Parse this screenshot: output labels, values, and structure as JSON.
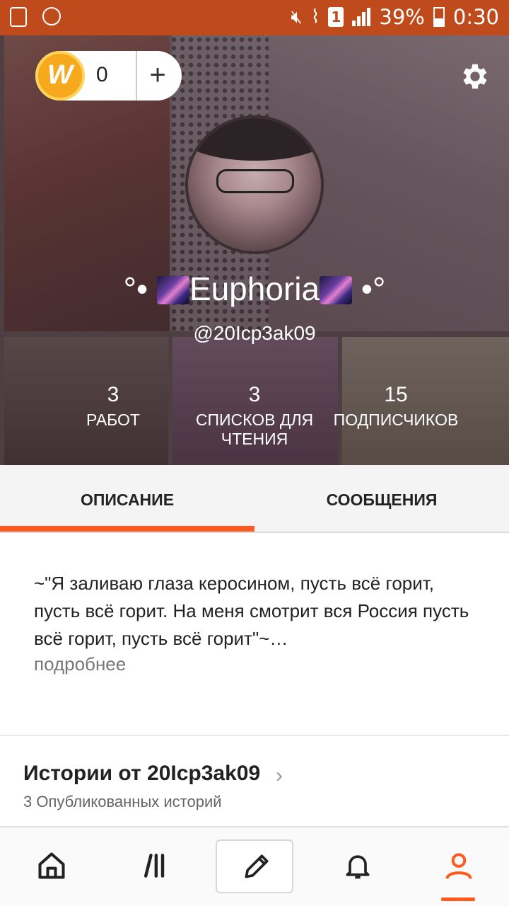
{
  "statusbar": {
    "battery": "39%",
    "time": "0:30",
    "sim": "1"
  },
  "wallet": {
    "coin_label": "W",
    "count": "0",
    "add_label": "+"
  },
  "profile": {
    "name_prefix": "°•",
    "name_text": "Euphoria",
    "name_suffix": "•°",
    "handle": "@20Icp3ak09",
    "stats": [
      {
        "num": "3",
        "label": "РАБОТ"
      },
      {
        "num": "3",
        "label": "СПИСКОВ ДЛЯ ЧТЕНИЯ"
      },
      {
        "num": "15",
        "label": "ПОДПИСЧИКОВ"
      }
    ]
  },
  "tabs": {
    "description": "ОПИСАНИЕ",
    "messages": "СООБЩЕНИЯ"
  },
  "description": {
    "text": "~\"Я заливаю глаза керосином, пусть всё горит, пусть всё горит. На меня смотрит вся Россия пусть всё горит, пусть всё горит\"~…",
    "more": "подробнее"
  },
  "stories": {
    "title": "Истории от 20Icp3ak09",
    "subtitle": "3 Опубликованных историй"
  },
  "colors": {
    "accent": "#ff5a1e",
    "statusbar": "#bf4a1c",
    "coin": "#f6a91d"
  },
  "nav": {
    "icons": [
      "home-icon",
      "library-icon",
      "write-icon",
      "notifications-icon",
      "profile-icon"
    ]
  }
}
